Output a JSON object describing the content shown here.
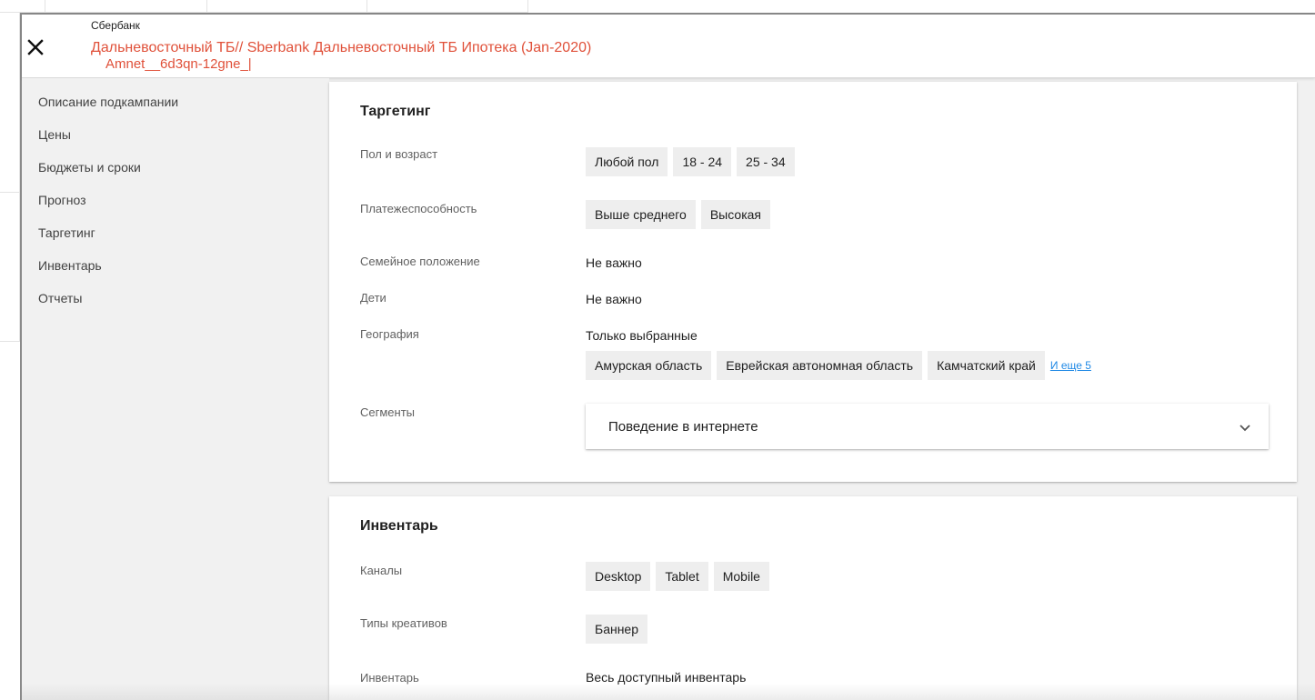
{
  "header": {
    "company": "Сбербанк",
    "campaign_title": "Дальневосточный ТБ// Sberbank Дальневосточный ТБ Ипотека (Jan-2020)",
    "campaign_sub": "Amnet__6d3qn-12gne_|"
  },
  "sidebar": {
    "items": [
      {
        "label": "Описание подкампании"
      },
      {
        "label": "Цены"
      },
      {
        "label": "Бюджеты и сроки"
      },
      {
        "label": "Прогноз"
      },
      {
        "label": "Таргетинг"
      },
      {
        "label": "Инвентарь"
      },
      {
        "label": "Отчеты"
      }
    ]
  },
  "targeting": {
    "title": "Таргетинг",
    "gender_age": {
      "label": "Пол и возраст",
      "chips": [
        "Любой пол",
        "18 - 24",
        "25 - 34"
      ]
    },
    "solvency": {
      "label": "Платежеспособность",
      "chips": [
        "Выше среднего",
        "Высокая"
      ]
    },
    "family": {
      "label": "Семейное положение",
      "value": "Не важно"
    },
    "children": {
      "label": "Дети",
      "value": "Не важно"
    },
    "geography": {
      "label": "География",
      "value": "Только выбранные",
      "chips": [
        "Амурская область",
        "Еврейская автономная область",
        "Камчатский край"
      ],
      "more": "И еще 5"
    },
    "segments": {
      "label": "Сегменты",
      "panel": "Поведение в интернете"
    }
  },
  "inventory": {
    "title": "Инвентарь",
    "channels": {
      "label": "Каналы",
      "chips": [
        "Desktop",
        "Tablet",
        "Mobile"
      ]
    },
    "creative_types": {
      "label": "Типы креативов",
      "chips": [
        "Баннер"
      ]
    },
    "inventory": {
      "label": "Инвентарь",
      "value": "Весь доступный инвентарь"
    }
  },
  "colors": {
    "accent": "#e0513a",
    "link": "#1e88e5"
  }
}
